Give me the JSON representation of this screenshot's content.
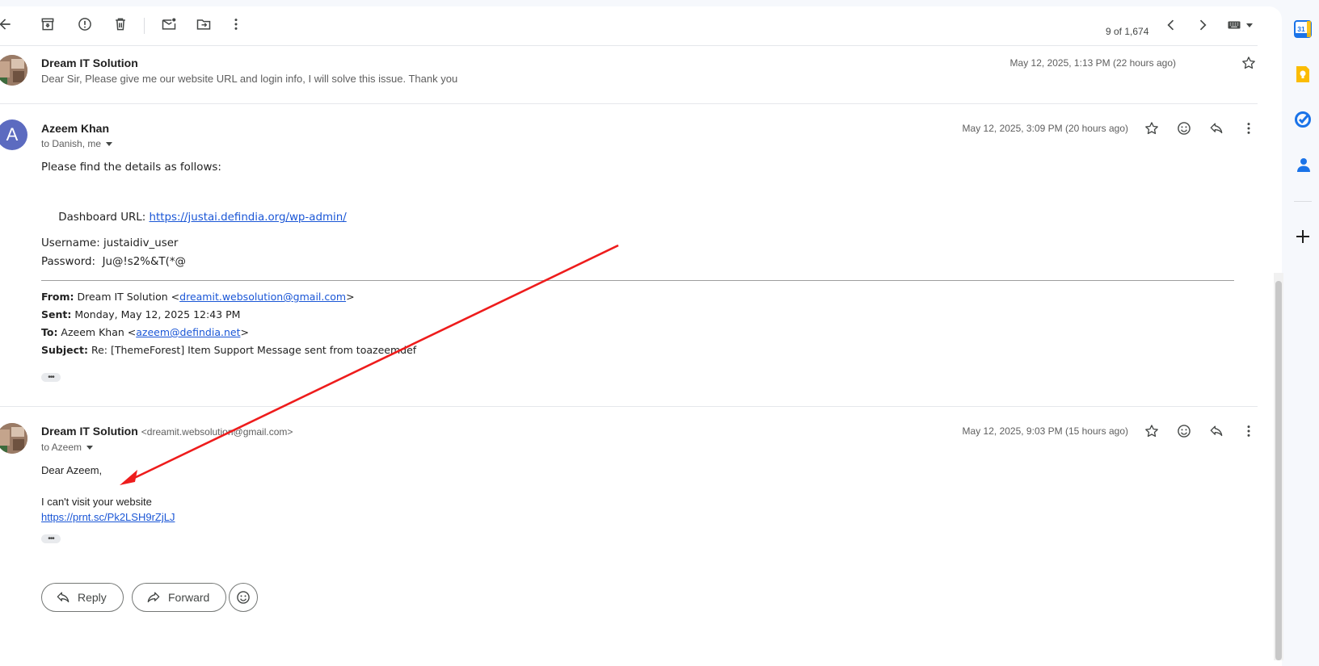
{
  "toolbar": {
    "pager": "9 of 1,674",
    "back_icon": "arrow-left-icon",
    "archive_icon": "archive-icon",
    "spam_icon": "report-spam-icon",
    "delete_icon": "trash-icon",
    "unread_icon": "mark-unread-icon",
    "move_icon": "move-to-icon",
    "more_icon": "more-vert-icon",
    "prev_icon": "chevron-left-icon",
    "next_icon": "chevron-right-icon",
    "input_tools_icon": "keyboard-icon"
  },
  "messages": [
    {
      "sender": "Dream IT Solution",
      "snippet": "Dear Sir, Please give me our website URL and login info, I will solve this issue. Thank you",
      "date": "May 12, 2025, 1:13 PM (22 hours ago)"
    },
    {
      "avatar_letter": "A",
      "sender": "Azeem Khan",
      "to": "to Danish, me",
      "date": "May 12, 2025, 3:09 PM (20 hours ago)",
      "body": {
        "line1": "Please find the details as follows:",
        "dashboard_label": " Dashboard URL: ",
        "dashboard_url": "https://justai.defindia.org/wp-admin/",
        "username": "Username: justaidiv_user",
        "password": "Password:  Ju@!s2%&T(*@"
      },
      "quoted": {
        "from_label": "From:",
        "from_name": " Dream IT Solution <",
        "from_email": "dreamit.websolution@gmail.com",
        "from_close": ">",
        "sent_label": "Sent:",
        "sent_value": " Monday, May 12, 2025 12:43 PM",
        "to_label": "To:",
        "to_name": " Azeem Khan <",
        "to_email": "azeem@defindia.net",
        "to_close": ">",
        "subject_label": "Subject:",
        "subject_value": " Re: [ThemeForest] Item Support Message sent from toazeemdef"
      },
      "dots": "•••"
    },
    {
      "sender": "Dream IT Solution",
      "sender_email": "<dreamit.websolution@gmail.com>",
      "to": "to Azeem",
      "date": "May 12, 2025, 9:03 PM (15 hours ago)",
      "body": {
        "greeting": "Dear Azeem,",
        "line1": "I can't visit your website",
        "link": "https://prnt.sc/Pk2LSH9rZjLJ"
      },
      "dots": "•••"
    }
  ],
  "actions": {
    "reply_label": "Reply",
    "forward_label": "Forward"
  },
  "side_panel": {
    "calendar_label": "31",
    "calendar_color": "#1a73e8",
    "keep_color": "#fbbc04",
    "tasks_color": "#1a73e8",
    "contacts_color": "#1a73e8"
  },
  "annotation_color": "#ee1c1c"
}
